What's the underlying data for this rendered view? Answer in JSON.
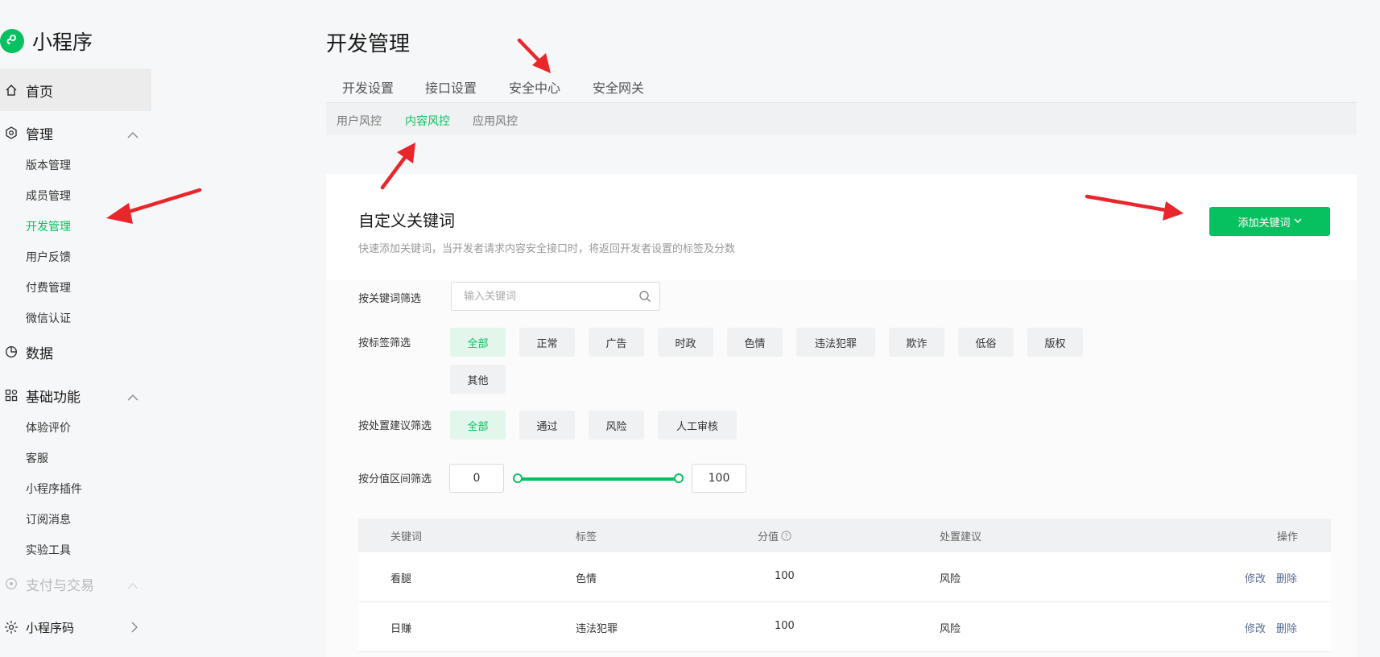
{
  "sidebar": {
    "brand": "小程序",
    "home": "首页",
    "manage": {
      "label": "管理",
      "items": [
        "版本管理",
        "成员管理",
        "开发管理",
        "用户反馈",
        "付费管理",
        "微信认证"
      ]
    },
    "data": "数据",
    "basic": {
      "label": "基础功能",
      "items": [
        "体验评价",
        "客服",
        "小程序插件",
        "订阅消息",
        "实验工具"
      ]
    },
    "payment": "支付与交易",
    "qrcode": "小程序码"
  },
  "page": {
    "title": "开发管理",
    "tabs": [
      "开发设置",
      "接口设置",
      "安全中心",
      "安全网关"
    ],
    "subtabs": [
      "用户风控",
      "内容风控",
      "应用风控"
    ]
  },
  "card": {
    "title": "自定义关键词",
    "description": "快速添加关键词，当开发者请求内容安全接口时，将返回开发者设置的标签及分数",
    "add_button": "添加关键词"
  },
  "filters": {
    "keyword_label": "按关键词筛选",
    "keyword_placeholder": "输入关键词",
    "tag_label": "按标签筛选",
    "tags": [
      "全部",
      "正常",
      "广告",
      "时政",
      "色情",
      "违法犯罪",
      "欺诈",
      "低俗",
      "版权",
      "其他"
    ],
    "suggest_label": "按处置建议筛选",
    "suggests": [
      "全部",
      "通过",
      "风险",
      "人工审核"
    ],
    "score_label": "按分值区间筛选",
    "score_min": "0",
    "score_max": "100"
  },
  "table": {
    "headers": [
      "关键词",
      "标签",
      "分值",
      "处置建议",
      "操作"
    ],
    "rows": [
      {
        "keyword": "看腿",
        "tag": "色情",
        "score": "100",
        "suggest": "风险",
        "edit": "修改",
        "delete": "删除"
      },
      {
        "keyword": "日赚",
        "tag": "违法犯罪",
        "score": "100",
        "suggest": "风险",
        "edit": "修改",
        "delete": "删除"
      }
    ]
  },
  "colors": {
    "accent": "#07c160",
    "annotation": "#e8262b",
    "link": "#576b95"
  },
  "icons": [
    "logo-icon",
    "home-icon",
    "settings-icon",
    "chevron-up-icon",
    "pie-chart-icon",
    "apps-icon",
    "wallet-icon",
    "qrcode-icon",
    "chevron-right-icon",
    "search-icon",
    "help-icon",
    "caret-down-icon"
  ]
}
